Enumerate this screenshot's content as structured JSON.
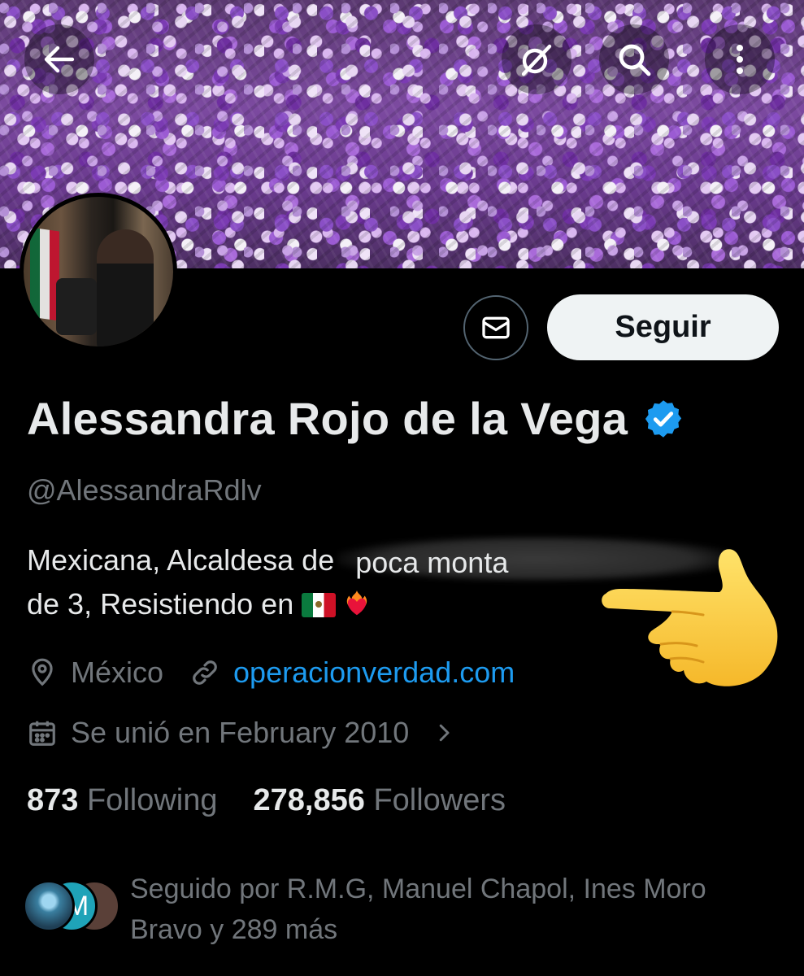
{
  "profile": {
    "name": "Alessandra Rojo de la Vega",
    "handle": "@AlessandraRdlv",
    "bio_line1": "Mexicana, Alcaldesa de",
    "bio_overlay": "poca monta",
    "bio_line2": "de 3, Resistiendo en",
    "location": "México",
    "website": "operacionverdad.com",
    "joined": "Se unió en February 2010"
  },
  "actions": {
    "follow_label": "Seguir"
  },
  "stats": {
    "following_count": "873",
    "following_label": "Following",
    "followers_count": "278,856",
    "followers_label": "Followers"
  },
  "followed_by": {
    "text": "Seguido por R.M.G, Manuel Chapol, Ines Moro Bravo y 289 más",
    "avatar_initial": "M"
  },
  "icons": {
    "back": "arrow-left-icon",
    "grok": "grok-icon",
    "search": "search-icon",
    "more": "more-vertical-icon",
    "message": "envelope-icon",
    "verified": "verified-badge-icon",
    "location": "location-pin-icon",
    "link": "link-icon",
    "calendar": "calendar-icon"
  },
  "colors": {
    "link": "#1d9bf0",
    "verified": "#1d9bf0",
    "follow_bg": "#eff3f4",
    "secondary_text": "#71767b"
  }
}
